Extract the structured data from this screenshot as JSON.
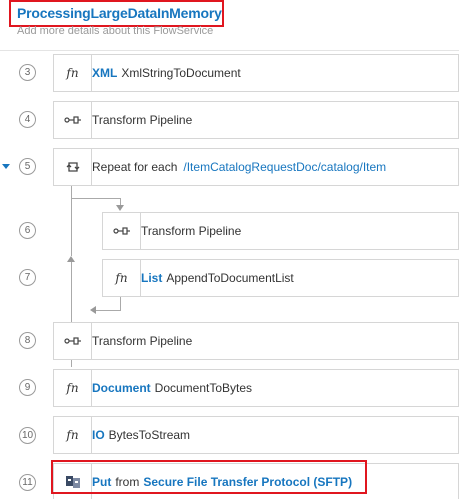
{
  "header": {
    "title": "ProcessingLargeDataInMemory",
    "subtitle": "Add more details about this FlowService"
  },
  "steps": [
    {
      "num": "3",
      "icon": "function-icon",
      "kw": "XML",
      "text": "XmlStringToDocument"
    },
    {
      "num": "4",
      "icon": "transform-icon",
      "text": "Transform Pipeline"
    },
    {
      "num": "5",
      "icon": "repeat-icon",
      "text": "Repeat for each",
      "path": "/ItemCatalogRequestDoc/catalog/Item"
    },
    {
      "num": "6",
      "icon": "transform-icon",
      "text": "Transform Pipeline"
    },
    {
      "num": "7",
      "icon": "function-icon",
      "kw": "List",
      "text": "AppendToDocumentList"
    },
    {
      "num": "8",
      "icon": "transform-icon",
      "text": "Transform Pipeline"
    },
    {
      "num": "9",
      "icon": "function-icon",
      "kw": "Document",
      "text": "DocumentToBytes"
    },
    {
      "num": "10",
      "icon": "function-icon",
      "kw": "IO",
      "text": "BytesToStream"
    },
    {
      "num": "11",
      "icon": "sftp-connector-icon",
      "kw": "Put",
      "mid": "from",
      "tail": "Secure File Transfer Protocol (SFTP)"
    }
  ],
  "glyphs": {
    "fn": "fn"
  },
  "colors": {
    "accent": "#1776bf",
    "highlight": "#e0161f",
    "border": "#d6d6d6"
  }
}
